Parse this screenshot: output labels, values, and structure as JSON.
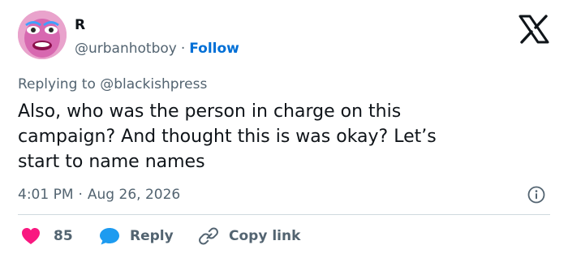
{
  "author": {
    "name": "R",
    "handle": "@urbanhotboy",
    "separator": "·",
    "follow_label": "Follow"
  },
  "reply_context": {
    "prefix": "Replying to",
    "mention": "@blackishpress"
  },
  "tweet": {
    "text": "Also, who was the person in charge on this\ncampaign? And thought this is was okay? Let’s\nstart to name names",
    "time": "4:01 PM",
    "separator": "·",
    "date": "Aug 26, 2026"
  },
  "actions": {
    "like_count": "85",
    "reply_label": "Reply",
    "copy_label": "Copy link"
  },
  "icons": {
    "logo": "x-logo-icon",
    "info": "info-icon",
    "like": "heart-icon",
    "reply": "speech-bubble-icon",
    "copy": "link-icon"
  },
  "colors": {
    "like": "#f91880",
    "reply": "#1d9bf0",
    "link": "#006fd6",
    "muted": "#536471",
    "text": "#0f1419",
    "divider": "#cfd9de"
  }
}
